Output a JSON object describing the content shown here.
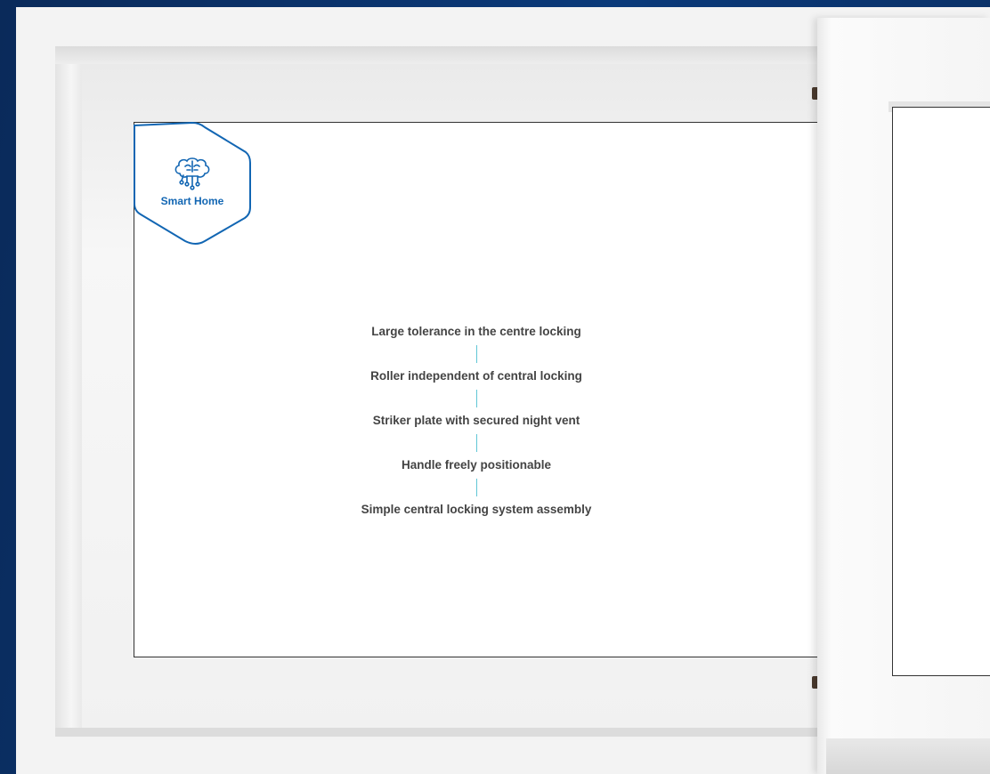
{
  "badge": {
    "label": "Smart Home",
    "icon": "brain-circuit-icon"
  },
  "features": [
    "Large tolerance in the centre locking",
    "Roller independent of central locking",
    "Striker plate with secured night vent",
    "Handle freely positionable",
    "Simple central locking system assembly"
  ],
  "colors": {
    "background_blue": "#0b3a7a",
    "accent_blue": "#1266b3",
    "separator_cyan": "#5fc6d6",
    "text": "#444444"
  }
}
